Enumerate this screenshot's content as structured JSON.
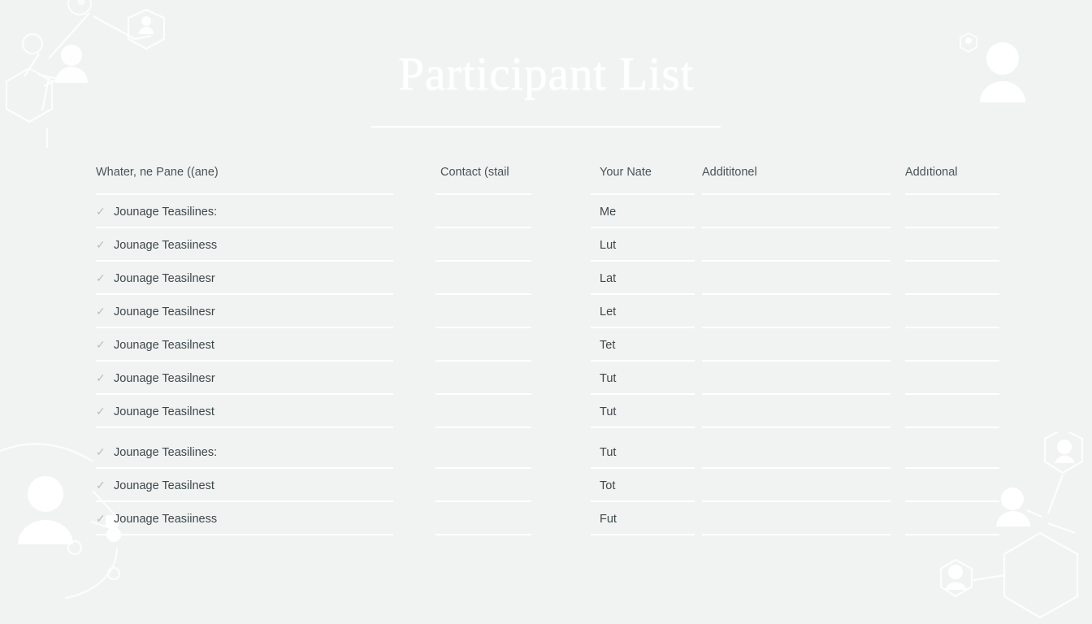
{
  "header": {
    "title": "Participant List"
  },
  "table": {
    "columns": [
      {
        "key": "name",
        "label": "Whater, ne Pane ((ane)"
      },
      {
        "key": "contact",
        "label": "Contact (stail"
      },
      {
        "key": "yourname",
        "label": "Your Nate"
      },
      {
        "key": "add1",
        "label": "Addititonel"
      },
      {
        "key": "add2",
        "label": "Addıtional"
      }
    ],
    "check_glyph": "✓",
    "rows": [
      {
        "name": "Jounage Teasilines:",
        "contact": "",
        "yourname": "Me",
        "add1": "",
        "add2": "",
        "checked": true
      },
      {
        "name": "Jounage Teasiiness",
        "contact": "",
        "yourname": "Lut",
        "add1": "",
        "add2": "",
        "checked": true
      },
      {
        "name": "Jounage Teasilnesr",
        "contact": "",
        "yourname": "Lat",
        "add1": "",
        "add2": "",
        "checked": true
      },
      {
        "name": "Jounage Teasilnesr",
        "contact": "",
        "yourname": "Let",
        "add1": "",
        "add2": "",
        "checked": true
      },
      {
        "name": "Jounage Teasilnest",
        "contact": "",
        "yourname": "Tet",
        "add1": "",
        "add2": "",
        "checked": true
      },
      {
        "name": "Jounage Teasilnesr",
        "contact": "",
        "yourname": "Tut",
        "add1": "",
        "add2": "",
        "checked": true
      },
      {
        "name": "Jounage Teasilnest",
        "contact": "",
        "yourname": "Tut",
        "add1": "",
        "add2": "",
        "checked": true
      },
      {
        "name": "Jounage Teasilines:",
        "contact": "",
        "yourname": "Tut",
        "add1": "",
        "add2": "",
        "checked": true
      },
      {
        "name": "Jounage Teasilnest",
        "contact": "",
        "yourname": "Tot",
        "add1": "",
        "add2": "",
        "checked": true
      },
      {
        "name": "Jounage Teasiiness",
        "contact": "",
        "yourname": "Fut",
        "add1": "",
        "add2": "",
        "checked": true
      }
    ]
  },
  "theme": {
    "background": "#f1f3f3",
    "rule": "#ffffff",
    "title_color": "#ffffff",
    "text_color": "#3e474a",
    "header_text_color": "#4a5356",
    "check_color": "#b6bfc1",
    "decor_color": "#ffffff"
  },
  "decorations": {
    "top_left": "network-people-graphic",
    "top_right": "person-avatar-graphic",
    "bottom_left": "person-network-graphic",
    "bottom_right": "hexagon-network-people-graphic"
  }
}
